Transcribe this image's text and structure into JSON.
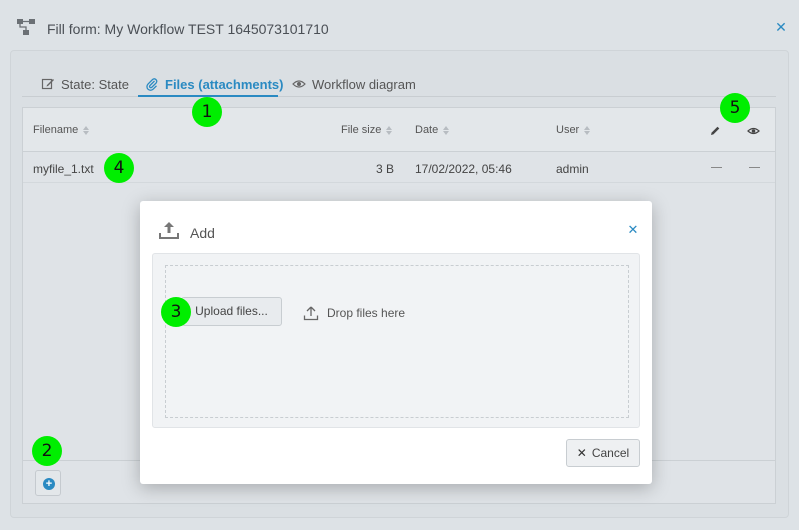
{
  "window": {
    "title": "Fill form: My Workflow TEST 1645073101710"
  },
  "tabs": [
    {
      "label": "State: State",
      "icon": "edit-icon"
    },
    {
      "label": "Files (attachments)",
      "icon": "paperclip-icon",
      "active": true
    },
    {
      "label": "Workflow diagram",
      "icon": "eye-icon"
    }
  ],
  "table": {
    "columns": [
      "Filename",
      "File size",
      "Date",
      "User"
    ],
    "action_icons": [
      "pencil-icon",
      "eye-icon"
    ],
    "rows": [
      {
        "filename": "myfile_1.txt",
        "size": "3 B",
        "date": "17/02/2022, 05:46",
        "user": "admin",
        "edit": "—",
        "view": "—"
      }
    ]
  },
  "modal": {
    "title": "Add",
    "upload_label": "Upload files...",
    "drop_label": "Drop files here",
    "cancel_label": "Cancel"
  },
  "markers": [
    "1",
    "2",
    "3",
    "4",
    "5"
  ],
  "colors": {
    "accent": "#2a8ac2",
    "marker": "#00ee00",
    "background": "#dde2e6"
  }
}
